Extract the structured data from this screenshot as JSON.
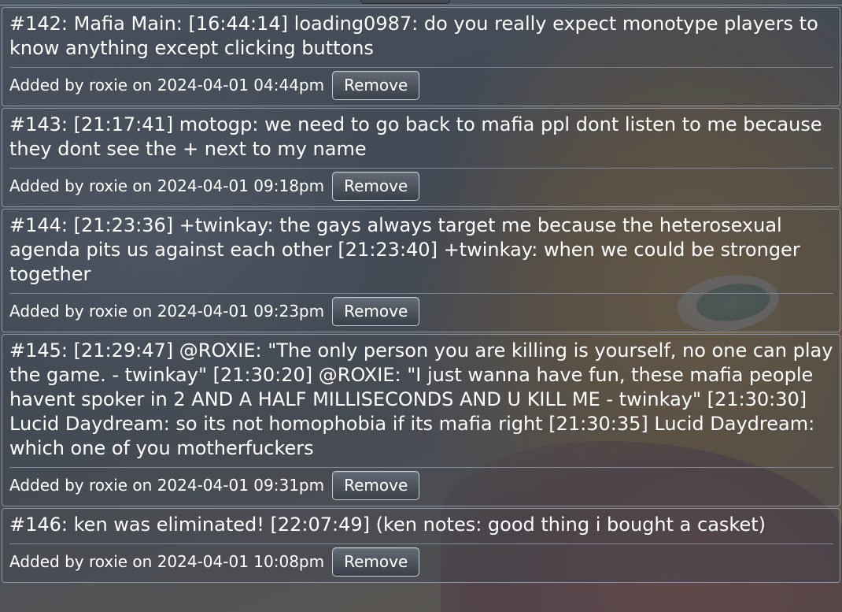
{
  "entries": [
    {
      "text": "#142: Mafia Main: [16:44:14] loading0987: do you really expect monotype players to know anything except clicking buttons",
      "meta": "Added by roxie on 2024-04-01 04:44pm",
      "button": "Remove"
    },
    {
      "text": "#143: [21:17:41] motogp: we need to go back to mafia ppl dont listen to me because they dont see the + next to my name",
      "meta": "Added by roxie on 2024-04-01 09:18pm",
      "button": "Remove"
    },
    {
      "text": "#144: [21:23:36] +twinkay: the gays always target me because the heterosexual agenda pits us against each other [21:23:40] +twinkay: when we could be stronger together",
      "meta": "Added by roxie on 2024-04-01 09:23pm",
      "button": "Remove"
    },
    {
      "text": "#145: [21:29:47] @ROXIE: \"The only person you are killing is yourself, no one can play the game. - twinkay\" [21:30:20] @ROXIE: \"I just wanna have fun, these mafia people havent spoker in 2 AND A HALF MILLISECONDS AND U KILL ME - twinkay\" [21:30:30] Lucid Daydream: so its not homophobia if its mafia right [21:30:35] Lucid Daydream: which one of you motherfuckers",
      "meta": "Added by roxie on 2024-04-01 09:31pm",
      "button": "Remove"
    },
    {
      "text": "#146: ken was eliminated! [22:07:49] (ken notes: good thing i bought a casket)",
      "meta": "Added by roxie on 2024-04-01 10:08pm",
      "button": "Remove"
    }
  ]
}
